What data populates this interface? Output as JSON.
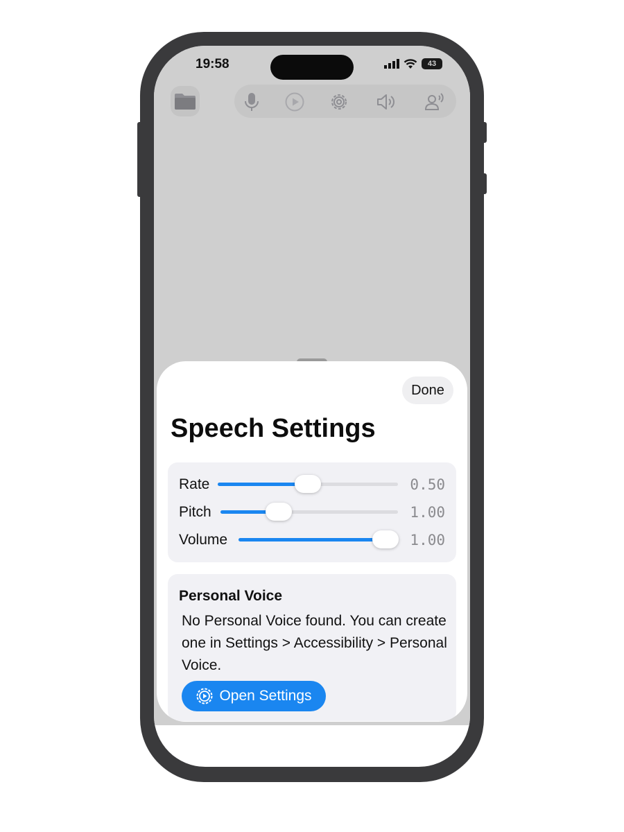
{
  "status_bar": {
    "time": "19:58",
    "battery": "43"
  },
  "sheet": {
    "done_label": "Done",
    "title": "Speech Settings",
    "sliders": [
      {
        "label": "Rate",
        "value_text": "0.50",
        "fraction": 0.5
      },
      {
        "label": "Pitch",
        "value_text": "1.00",
        "fraction": 0.33
      },
      {
        "label": "Volume",
        "value_text": "1.00",
        "fraction": 1.0
      }
    ],
    "personal_voice": {
      "title": "Personal Voice",
      "message": "No Personal Voice found. You can create one in Settings > Accessibility > Personal Voice.",
      "button_label": "Open Settings"
    }
  },
  "colors": {
    "accent": "#1a86f0",
    "dim": "#cfcfcf"
  },
  "icons": [
    "folder-icon",
    "microphone-icon",
    "play-icon",
    "gear-icon",
    "speaker-icon",
    "voice-profile-icon"
  ]
}
